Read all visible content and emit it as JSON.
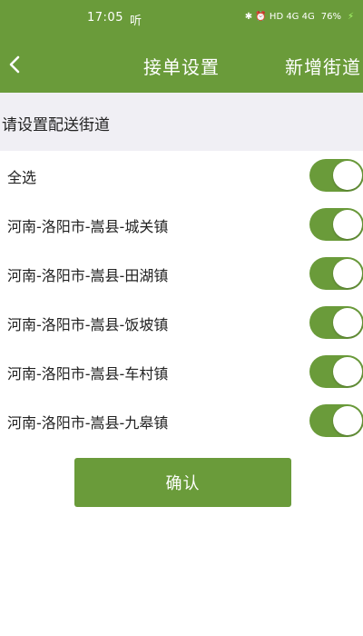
{
  "status_bar": {
    "time": "17:05",
    "app_indicator": "听",
    "right_icons": "✱ ⏰ HD 4G 4G",
    "battery": "76%"
  },
  "nav": {
    "title": "接单设置",
    "action": "新增街道"
  },
  "section": {
    "header": "请设置配送街道"
  },
  "items": [
    {
      "label": "全选",
      "enabled": true
    },
    {
      "label": "河南-洛阳市-嵩县-城关镇",
      "enabled": true
    },
    {
      "label": "河南-洛阳市-嵩县-田湖镇",
      "enabled": true
    },
    {
      "label": "河南-洛阳市-嵩县-饭坡镇",
      "enabled": true
    },
    {
      "label": "河南-洛阳市-嵩县-车村镇",
      "enabled": true
    },
    {
      "label": "河南-洛阳市-嵩县-九皋镇",
      "enabled": true
    }
  ],
  "confirm_label": "确认",
  "colors": {
    "primary": "#6a9b3a",
    "section_bg": "#f0eff4"
  }
}
